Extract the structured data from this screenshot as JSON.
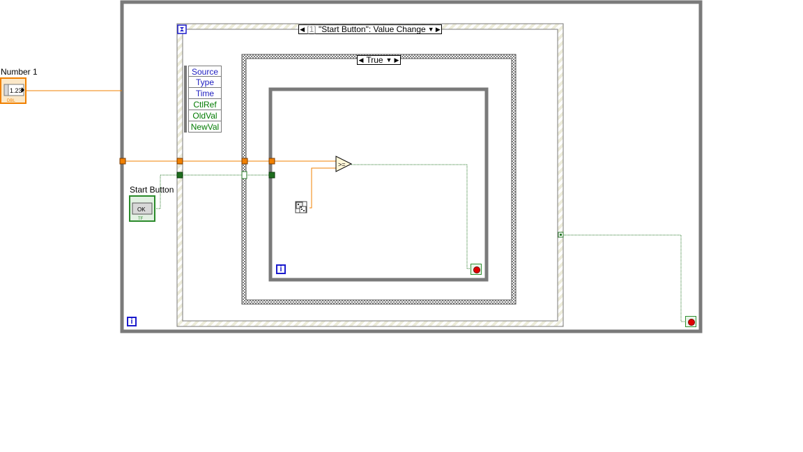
{
  "controls": {
    "number1_label": "Number 1",
    "number1_value": "1.23",
    "number1_type": "DBL",
    "start_button_label": "Start Button",
    "start_button_text": "OK",
    "start_button_type": "TF"
  },
  "event_structure": {
    "case_index": "[1]",
    "case_label": "\"Start Button\": Value Change",
    "event_data": [
      {
        "name": "Source",
        "color": "blue"
      },
      {
        "name": "Type",
        "color": "blue"
      },
      {
        "name": "Time",
        "color": "blue"
      },
      {
        "name": "CtlRef",
        "color": "green"
      },
      {
        "name": "OldVal",
        "color": "green"
      },
      {
        "name": "NewVal",
        "color": "green"
      }
    ]
  },
  "case_structure": {
    "selector": "True"
  },
  "loops": {
    "outer_iteration": "i",
    "inner_iteration": "i"
  },
  "functions": {
    "compare_symbol": ">=",
    "random_icon": "dice-icon"
  },
  "colors": {
    "dbl_wire": "#f08000",
    "bool_wire": "#2a7a2a",
    "loop_border": "#7a7a7a",
    "event_border": "#d9d9c0",
    "iteration": "#1a1acc",
    "stop": "#e00000"
  }
}
